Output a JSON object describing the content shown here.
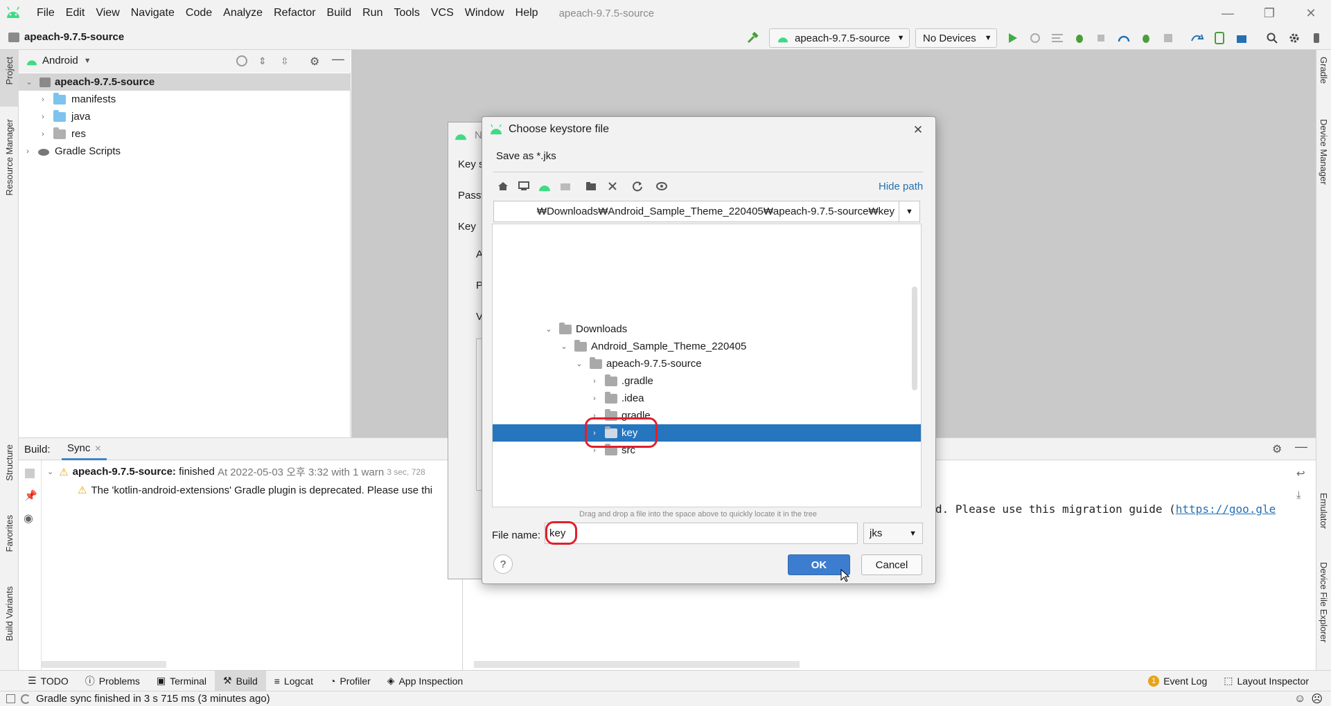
{
  "window": {
    "title": "apeach-9.7.5-source",
    "menu": [
      "File",
      "Edit",
      "View",
      "Navigate",
      "Code",
      "Analyze",
      "Refactor",
      "Build",
      "Run",
      "Tools",
      "VCS",
      "Window",
      "Help"
    ]
  },
  "toolbar": {
    "project_name": "apeach-9.7.5-source",
    "run_config": "apeach-9.7.5-source",
    "device": "No Devices"
  },
  "left_strip": [
    "Project",
    "Resource Manager",
    "Structure",
    "Favorites",
    "Build Variants"
  ],
  "right_strip": [
    "Gradle",
    "Device Manager",
    "Emulator",
    "Device File Explorer"
  ],
  "project_panel": {
    "view_selector": "Android",
    "root": "apeach-9.7.5-source",
    "children": [
      "manifests",
      "java",
      "res"
    ],
    "gradle": "Gradle Scripts"
  },
  "build_panel": {
    "tab_label": "Build:",
    "sync_tab": "Sync",
    "sync_project": "apeach-9.7.5-source:",
    "sync_status": "finished",
    "sync_time": "At 2022-05-03 오후 3:32 with 1 warn",
    "sync_duration": "3 sec, 728",
    "warning": "The 'kotlin-android-extensions' Gradle plugin is deprecated. Please use thi",
    "console_text": "d. Please use this migration guide (",
    "console_link": "https://goo.gle"
  },
  "back_dialog": {
    "title": "N",
    "labels": [
      "Key s",
      "Passw",
      "Key",
      "A",
      "P",
      "V"
    ]
  },
  "dialog": {
    "title": "Choose keystore file",
    "save_as": "Save as *.jks",
    "hide_path": "Hide path",
    "path": "₩Downloads₩Android_Sample_Theme_220405₩apeach-9.7.5-source₩key",
    "tree": [
      {
        "label": "Downloads",
        "depth": 0,
        "expanded": true
      },
      {
        "label": "Android_Sample_Theme_220405",
        "depth": 1,
        "expanded": true
      },
      {
        "label": "apeach-9.7.5-source",
        "depth": 2,
        "expanded": true
      },
      {
        "label": ".gradle",
        "depth": 3,
        "expanded": false
      },
      {
        "label": ".idea",
        "depth": 3,
        "expanded": false
      },
      {
        "label": "gradle",
        "depth": 3,
        "expanded": false
      },
      {
        "label": "key",
        "depth": 3,
        "expanded": false,
        "selected": true
      },
      {
        "label": "src",
        "depth": 3,
        "expanded": false
      }
    ],
    "drag_hint": "Drag and drop a file into the space above to quickly locate it in the tree",
    "file_name_label": "File name:",
    "file_name_value": "key",
    "file_type": "jks",
    "ok": "OK",
    "cancel": "Cancel",
    "help": "?"
  },
  "bottom_tabs": [
    "TODO",
    "Problems",
    "Terminal",
    "Build",
    "Logcat",
    "Profiler",
    "App Inspection"
  ],
  "bottom_right": {
    "event_log_count": "1",
    "event_log": "Event Log",
    "layout_inspector": "Layout Inspector"
  },
  "status": "Gradle sync finished in 3 s 715 ms (3 minutes ago)",
  "colors": {
    "android_green": "#3ddc84",
    "selection": "#2675bf",
    "accent_link": "#2470b3",
    "folder_blue": "#7dc3ee",
    "highlight_ring": "#e0202a"
  }
}
